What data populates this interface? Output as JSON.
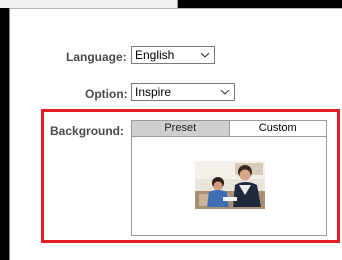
{
  "language": {
    "label": "Language:",
    "value": "English"
  },
  "option": {
    "label": "Option:",
    "value": "Inspire"
  },
  "background": {
    "label": "Background:",
    "tabs": [
      {
        "label": "Preset",
        "active": true
      },
      {
        "label": "Custom",
        "active": false
      }
    ],
    "preview_image": "teacher-and-child-photo"
  },
  "highlight_color": "#e31e24",
  "icons": {
    "dropdown": "chevron-down-icon"
  }
}
